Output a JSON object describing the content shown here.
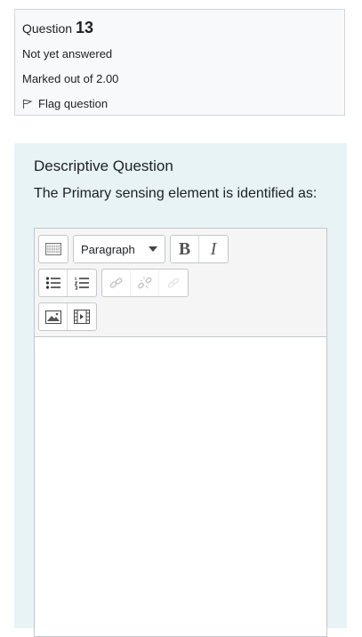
{
  "question_info": {
    "prefix": "Question",
    "number": "13",
    "status": "Not yet answered",
    "marks": "Marked out of 2.00",
    "flag_label": "Flag question"
  },
  "question": {
    "type_title": "Descriptive Question",
    "text": "The Primary sensing element is identified as:"
  },
  "editor": {
    "format_select": "Paragraph",
    "bold_label": "B",
    "italic_label": "I",
    "answer": ""
  },
  "icons": [
    "toolbar-toggle-icon",
    "chevron-down-icon",
    "unordered-list-icon",
    "ordered-list-icon",
    "link-icon",
    "unlink-icon",
    "emoticon-icon",
    "image-icon",
    "media-icon",
    "flag-icon"
  ],
  "colors": {
    "info_bg": "#f8f9fa",
    "content_bg": "#e7f3f5",
    "border": "#c4c7cb"
  }
}
